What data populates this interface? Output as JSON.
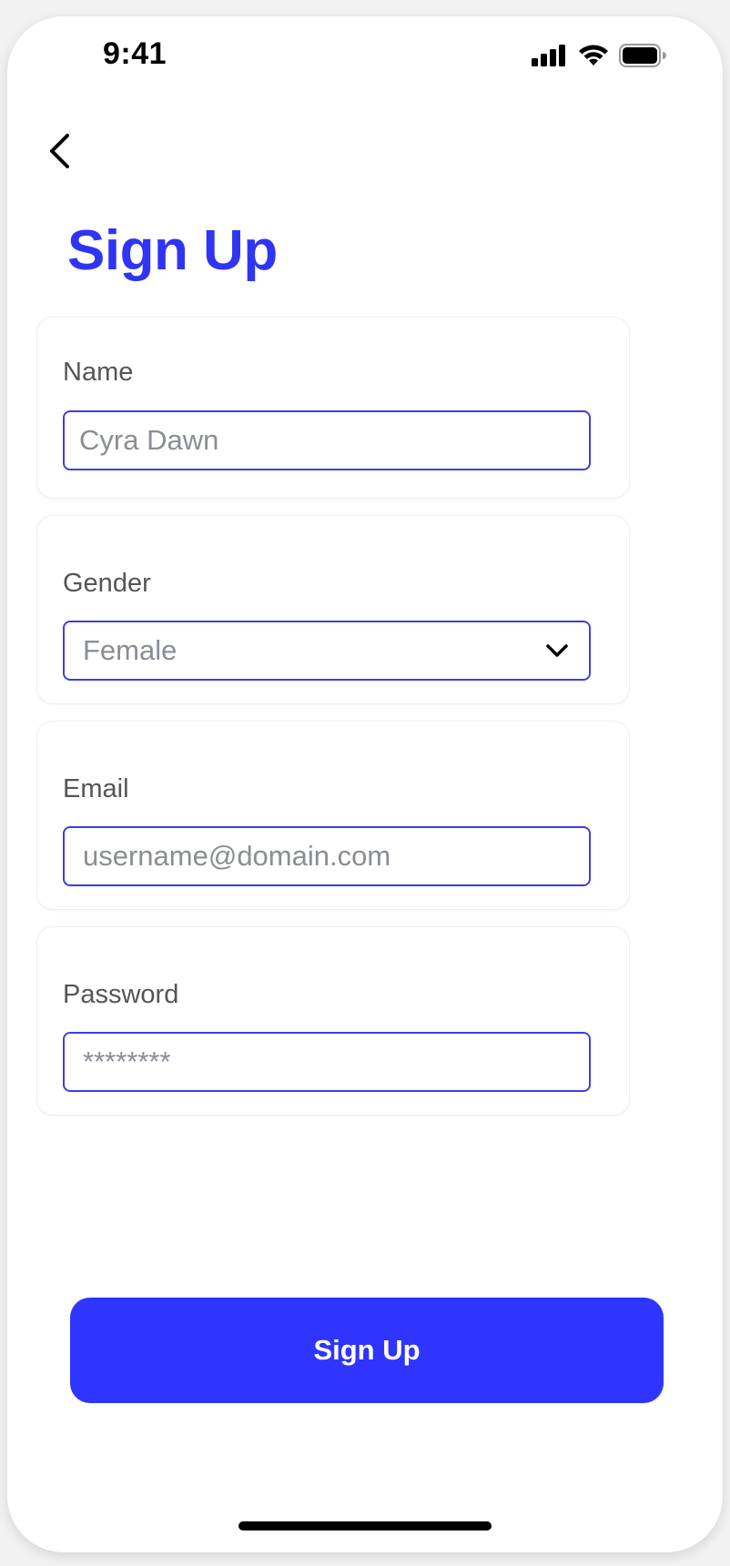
{
  "status_bar": {
    "time": "9:41",
    "icons": [
      "signal-icon",
      "wifi-icon",
      "battery-icon"
    ]
  },
  "header": {
    "back_icon": "chevron-left-icon",
    "title": "Sign Up"
  },
  "form": {
    "name": {
      "label": "Name",
      "placeholder": "Cyra Dawn"
    },
    "gender": {
      "label": "Gender",
      "selected": "Female",
      "icon": "chevron-down-icon"
    },
    "email": {
      "label": "Email",
      "placeholder": "username@domain.com"
    },
    "password": {
      "label": "Password",
      "placeholder": "********"
    }
  },
  "actions": {
    "submit_label": "Sign Up"
  },
  "colors": {
    "accent": "#2f35f3",
    "button": "#2f35ff",
    "field_border": "#3a3fe6",
    "label_text": "#555555",
    "placeholder_text": "#8a8d96"
  }
}
